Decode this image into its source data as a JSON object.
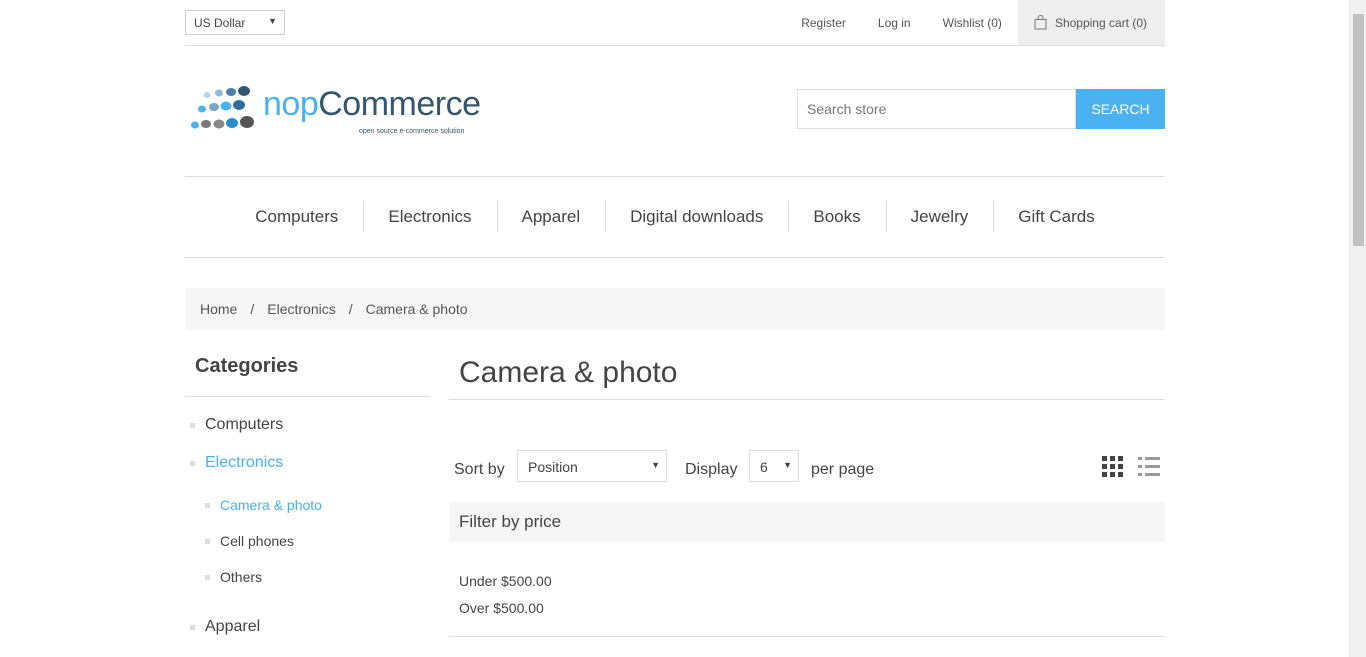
{
  "header": {
    "currency": "US Dollar",
    "links": {
      "register": "Register",
      "login": "Log in",
      "wishlist": "Wishlist (0)",
      "cart": "Shopping cart (0)"
    }
  },
  "logo": {
    "brand_light": "nop",
    "brand_dark": "Commerce",
    "tagline": "open source e-commerce solution"
  },
  "search": {
    "placeholder": "Search store",
    "button": "Search"
  },
  "menu": [
    "Computers",
    "Electronics",
    "Apparel",
    "Digital downloads",
    "Books",
    "Jewelry",
    "Gift Cards"
  ],
  "breadcrumb": {
    "items": [
      "Home",
      "Electronics",
      "Camera & photo"
    ],
    "separator": "/"
  },
  "categories": {
    "title": "Categories",
    "items": [
      "Computers",
      "Electronics",
      "Apparel"
    ],
    "sub_items": [
      "Camera & photo",
      "Cell phones",
      "Others"
    ]
  },
  "page": {
    "title": "Camera & photo",
    "sort_label": "Sort by",
    "sort_value": "Position",
    "display_label": "Display",
    "display_value": "6",
    "per_page_label": "per page",
    "view_modes": [
      "grid-icon",
      "list-icon"
    ]
  },
  "filter": {
    "title": "Filter by price",
    "ranges": [
      "Under $500.00",
      "Over $500.00"
    ]
  },
  "colors": {
    "accent": "#4ab2f1",
    "logo_dark": "#34566e",
    "border": "#dddddd",
    "panel": "#f6f6f6"
  }
}
